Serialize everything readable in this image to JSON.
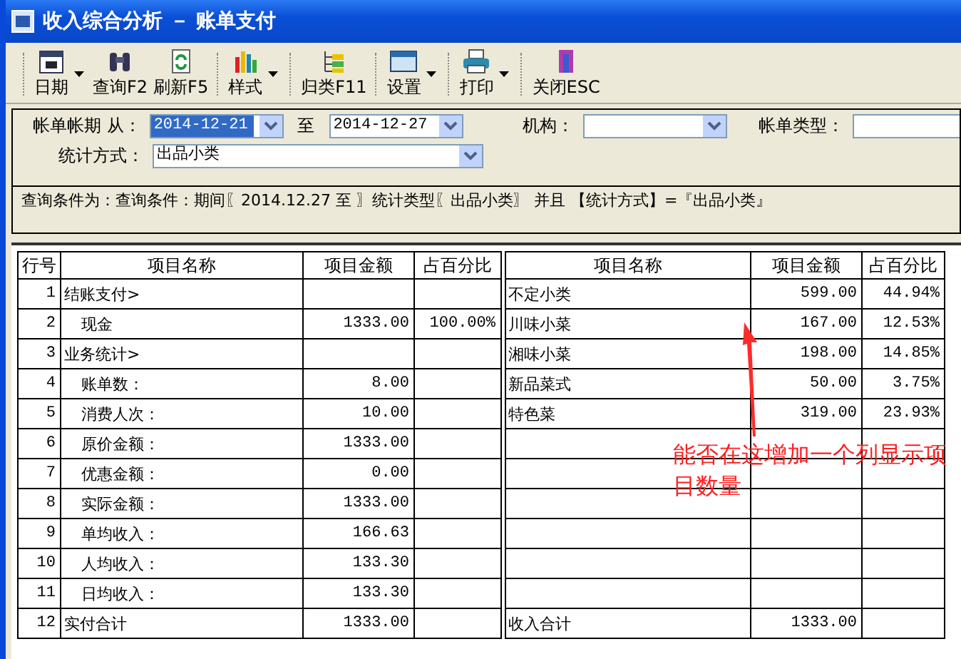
{
  "window": {
    "title": "收入综合分析 － 账单支付"
  },
  "toolbar": [
    {
      "label": "日期",
      "has_menu": true
    },
    {
      "label": "查询F2",
      "has_menu": false
    },
    {
      "label": "刷新F5",
      "has_menu": false
    },
    {
      "label": "样式",
      "has_menu": true
    },
    {
      "label": "归类F11",
      "has_menu": false
    },
    {
      "label": "设置",
      "has_menu": true
    },
    {
      "label": "打印",
      "has_menu": true
    },
    {
      "label": "关闭ESC",
      "has_menu": false
    }
  ],
  "filters": {
    "period_label": "帐单帐期 从：",
    "from": "2014-12-21",
    "from_selected": true,
    "to_label": "至",
    "to": "2014-12-27",
    "org_label": "机构：",
    "bill_type_label": "帐单类型：",
    "method_label": "统计方式：",
    "method": "出品小类"
  },
  "query_condition": "查询条件为：查询条件：期间〖2014.12.27 至 〗统计类型〖出品小类〗 并且 【统计方式】=『出品小类』",
  "table": {
    "left_columns": [
      "行号",
      "项目名称",
      "项目金额",
      "占百分比"
    ],
    "right_columns": [
      "项目名称",
      "项目金额",
      "占百分比"
    ],
    "rows": [
      {
        "no": "1",
        "name": "结账支付>",
        "right": {
          "name": "不定小类",
          "amount": "599.00",
          "percent": "44.94%"
        },
        "children": [
          {
            "no": "2",
            "name": "现金",
            "amount": "1333.00",
            "percent": "100.00%",
            "right": {
              "name": "川味小菜",
              "amount": "167.00",
              "percent": "12.53%"
            }
          }
        ]
      },
      {
        "no": "3",
        "name": "业务统计>",
        "right": {
          "name": "湘味小菜",
          "amount": "198.00",
          "percent": "14.85%"
        },
        "children": [
          {
            "no": "4",
            "name": "账单数：",
            "amount": "8.00",
            "right": {
              "name": "新品菜式",
              "amount": "50.00",
              "percent": "3.75%"
            }
          },
          {
            "no": "5",
            "name": "消费人次：",
            "amount": "10.00",
            "right": {
              "name": "特色菜",
              "amount": "319.00",
              "percent": "23.93%"
            }
          },
          {
            "no": "6",
            "name": "原价金额：",
            "amount": "1333.00"
          },
          {
            "no": "7",
            "name": "优惠金额：",
            "amount": "0.00"
          },
          {
            "no": "8",
            "name": "实际金额：",
            "amount": "1333.00"
          },
          {
            "no": "9",
            "name": "单均收入：",
            "amount": "166.63"
          },
          {
            "no": "10",
            "name": "人均收入：",
            "amount": "133.30"
          },
          {
            "no": "11",
            "name": "日均收入：",
            "amount": "133.30"
          }
        ]
      },
      {
        "no": "12",
        "name": "实付合计",
        "amount": "1333.00",
        "right": {
          "name": "收入合计",
          "amount": "1333.00"
        }
      }
    ]
  },
  "annotation": {
    "text": "能否在这增加一个列显示项目数量"
  }
}
